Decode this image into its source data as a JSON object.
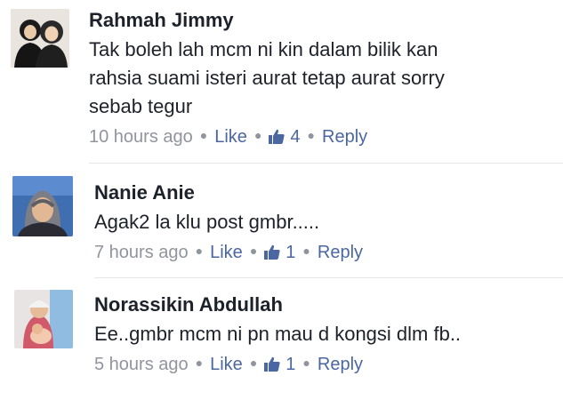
{
  "comments": [
    {
      "author": "Rahmah Jimmy",
      "text_lines": [
        "Tak boleh lah mcm ni kin dalam bilik kan",
        "rahsia suami isteri aurat tetap aurat sorry",
        "sebab tegur"
      ],
      "time": "10 hours ago",
      "like_label": "Like",
      "like_count": "4",
      "reply_label": "Reply"
    },
    {
      "author": "Nanie Anie",
      "text_lines": [
        "Agak2 la klu post gmbr....."
      ],
      "time": "7 hours ago",
      "like_label": "Like",
      "like_count": "1",
      "reply_label": "Reply"
    },
    {
      "author": "Norassikin Abdullah",
      "text_lines": [
        "Ee..gmbr mcm ni pn mau d kongsi dlm fb.."
      ],
      "time": "5 hours ago",
      "like_label": "Like",
      "like_count": "1",
      "reply_label": "Reply"
    }
  ],
  "colors": {
    "link": "#4b67a1",
    "meta": "#90949c",
    "text": "#1d2129"
  },
  "icons": {
    "like": "thumbs-up-icon",
    "separator": "middle-dot"
  }
}
